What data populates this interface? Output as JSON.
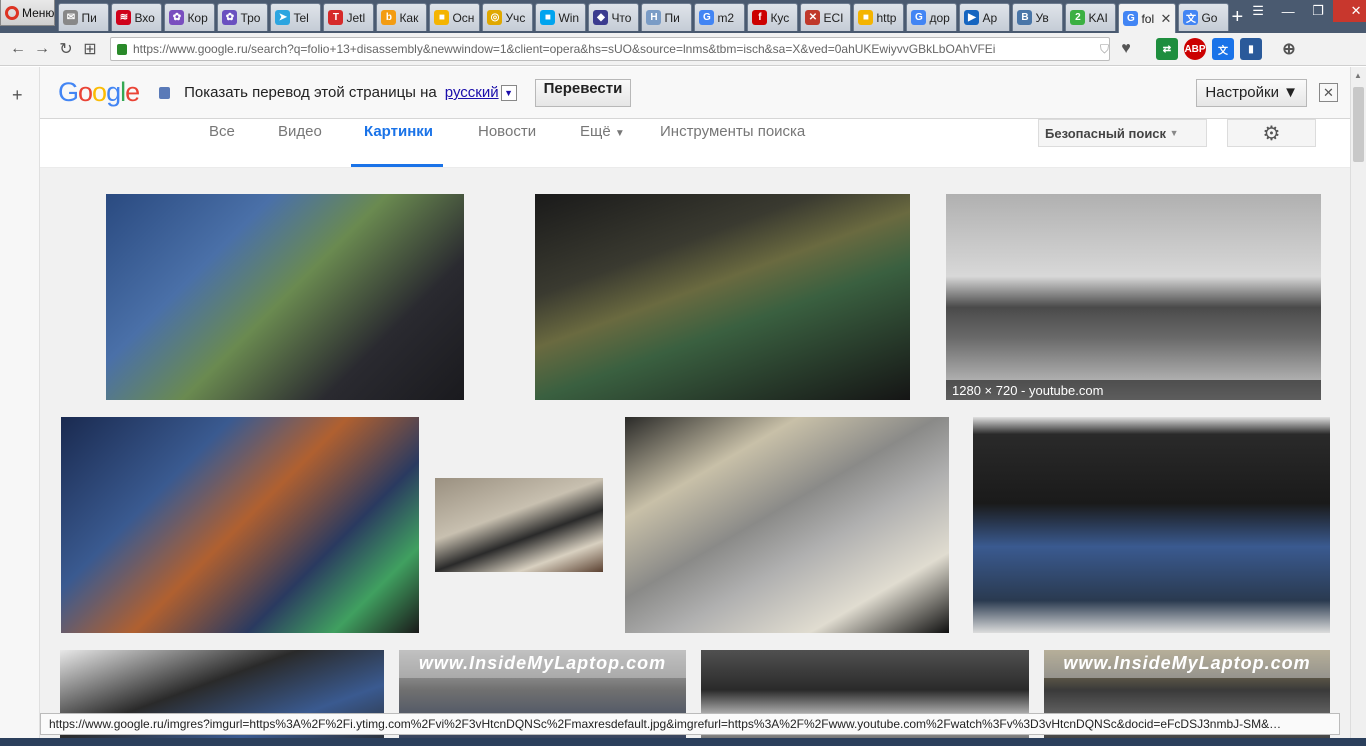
{
  "browser": {
    "menu_label": "Меню",
    "tabs": [
      {
        "label": "Пи",
        "color": "#888888",
        "glyph": "✉"
      },
      {
        "label": "Вхо",
        "color": "#d0021b",
        "glyph": "≋"
      },
      {
        "label": "Кор",
        "color": "#7a4fbf",
        "glyph": "✿"
      },
      {
        "label": "Тро",
        "color": "#6a50c0",
        "glyph": "✿"
      },
      {
        "label": "Tel",
        "color": "#2ca5e0",
        "glyph": "➤"
      },
      {
        "label": "Jetl",
        "color": "#d62a2a",
        "glyph": "T"
      },
      {
        "label": "Как",
        "color": "#f39c12",
        "glyph": "b"
      },
      {
        "label": "Осн",
        "color": "#f4b400",
        "glyph": "■"
      },
      {
        "label": "Учс",
        "color": "#e0a800",
        "glyph": "◎"
      },
      {
        "label": "Win",
        "color": "#00a4ef",
        "glyph": "■"
      },
      {
        "label": "Что",
        "color": "#3b3b8f",
        "glyph": "◆"
      },
      {
        "label": "Пи",
        "color": "#7a9cc6",
        "glyph": "H"
      },
      {
        "label": "m2",
        "color": "#4285f4",
        "glyph": "G"
      },
      {
        "label": "Кус",
        "color": "#cc0000",
        "glyph": "f"
      },
      {
        "label": "ECI",
        "color": "#c0392b",
        "glyph": "✕"
      },
      {
        "label": "http",
        "color": "#f4b400",
        "glyph": "■"
      },
      {
        "label": "дор",
        "color": "#4285f4",
        "glyph": "G"
      },
      {
        "label": "Ар",
        "color": "#1565c0",
        "glyph": "▶"
      },
      {
        "label": "Ув",
        "color": "#4a76a8",
        "glyph": "B"
      },
      {
        "label": "KAI",
        "color": "#3cb043",
        "glyph": "2"
      },
      {
        "label": "fol",
        "color": "#4285f4",
        "glyph": "G",
        "active": true
      },
      {
        "label": "Go",
        "color": "#4285f4",
        "glyph": "文"
      }
    ],
    "url": "https://www.google.ru/search?q=folio+13+disassembly&newwindow=1&client=opera&hs=sUO&source=lnms&tbm=isch&sa=X&ved=0ahUKEwiyvvGBkLbOAhVFEi"
  },
  "translate_bar": {
    "logo": [
      "G",
      "o",
      "o",
      "g",
      "l",
      "e"
    ],
    "prompt": "Показать перевод этой страницы на",
    "language": "русский",
    "translate_button": "Перевести",
    "settings_button": "Настройки ▼"
  },
  "search_nav": {
    "all": "Все",
    "video": "Видео",
    "images": "Картинки",
    "news": "Новости",
    "more": "Ещё",
    "tools": "Инструменты поиска",
    "safe_search": "Безопасный поиск",
    "gear": "⚙"
  },
  "results": {
    "hover_caption": "1280 × 720 - youtube.com",
    "watermark": "www.InsideMyLaptop.com"
  },
  "status": {
    "url": "https://www.google.ru/imgres?imgurl=https%3A%2F%2Fi.ytimg.com%2Fvi%2F3vHtcnDQNSc%2Fmaxresdefault.jpg&imgrefurl=https%3A%2F%2Fwww.youtube.com%2Fwatch%3Fv%3D3vHtcnDQNSc&docid=eFcDSJ3nmbJ-SM&…"
  },
  "colors": {
    "tab_bar": "#4a5a70",
    "link_blue": "#1a73e8"
  }
}
